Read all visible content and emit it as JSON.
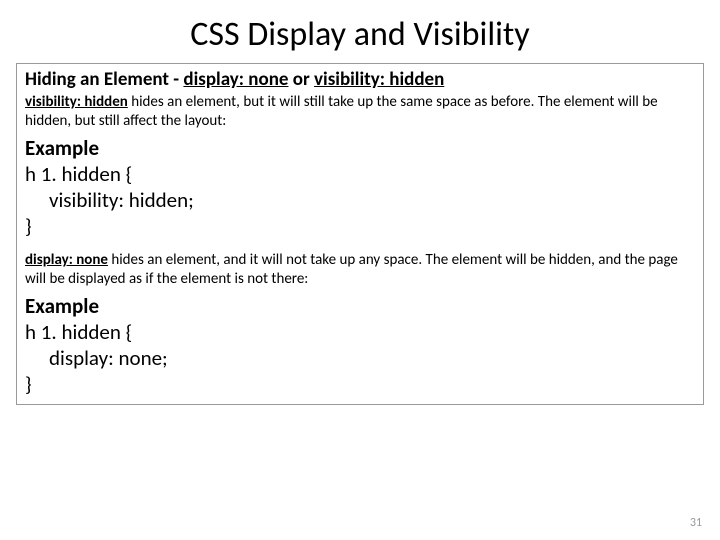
{
  "title": "CSS Display and Visibility",
  "subheading": {
    "prefix": "Hiding an Element - ",
    "term1": "display: none",
    "mid": " or ",
    "term2": "visibility: hidden"
  },
  "vis": {
    "bold": "visibility: hidden",
    "rest": " hides an element, but it will still take up the same space as before. The element will be hidden, but still affect the layout:"
  },
  "example_label": "Example",
  "code_vis": {
    "line1": "h 1. hidden {",
    "line2": "visibility: hidden;",
    "line3": "}"
  },
  "disp": {
    "bold": "display: none",
    "rest": " hides an element, and it will not take up any space. The element will be hidden, and the page will be displayed as if the element is not there:"
  },
  "code_disp": {
    "line1": "h 1. hidden {",
    "line2": "display: none;",
    "line3": "}"
  },
  "page_number": "31"
}
